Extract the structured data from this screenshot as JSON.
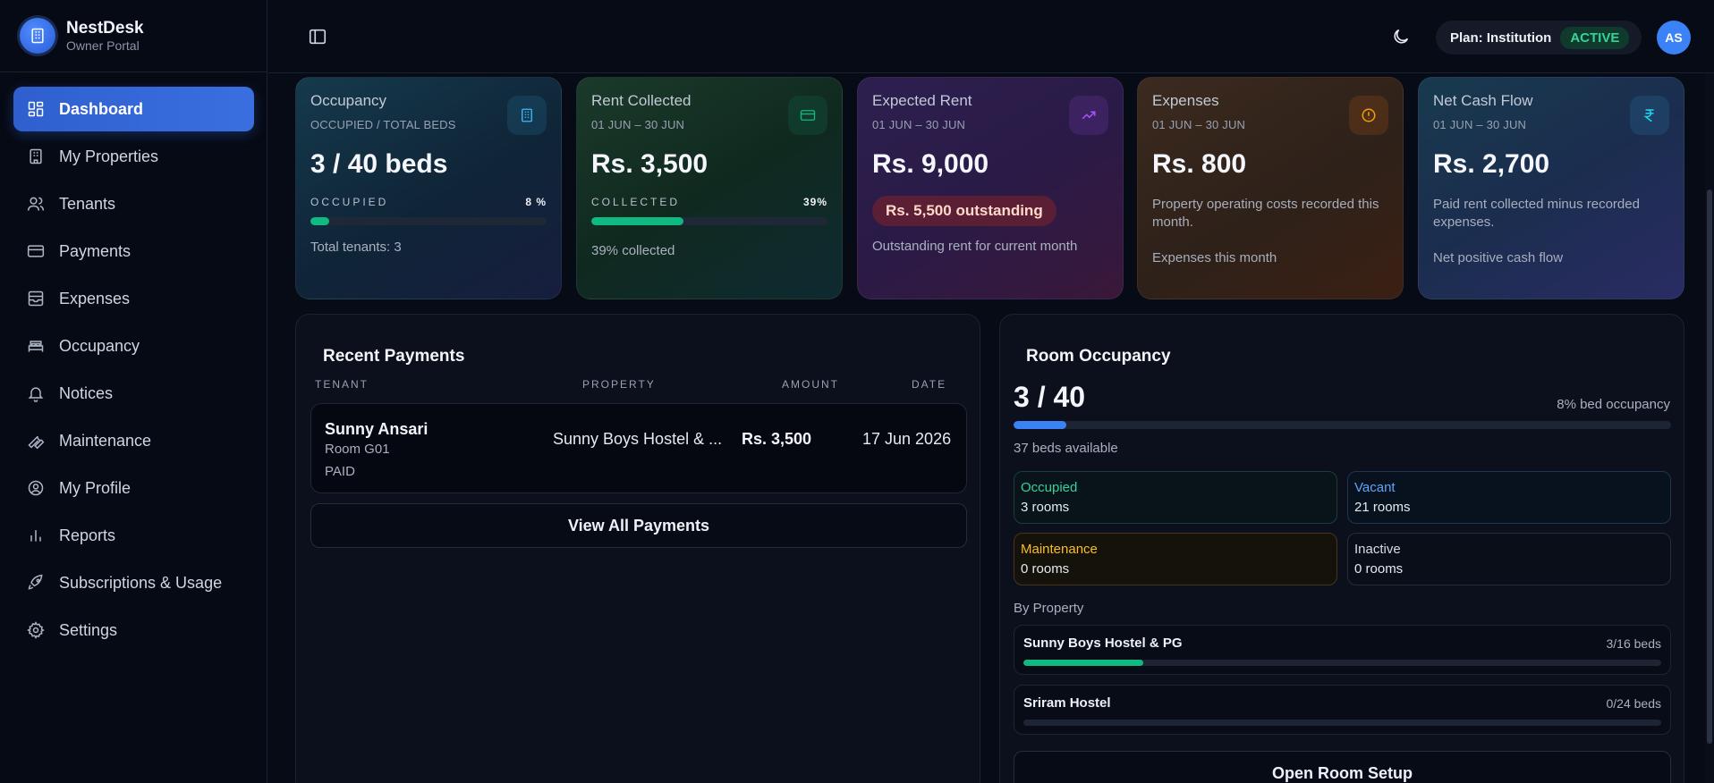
{
  "brand": {
    "name": "NestDesk",
    "subtitle": "Owner Portal"
  },
  "sidebar": {
    "items": [
      {
        "label": "Dashboard",
        "icon": "dashboard-icon",
        "active": true
      },
      {
        "label": "My Properties",
        "icon": "building-icon"
      },
      {
        "label": "Tenants",
        "icon": "users-icon"
      },
      {
        "label": "Payments",
        "icon": "credit-card-icon"
      },
      {
        "label": "Expenses",
        "icon": "archive-icon"
      },
      {
        "label": "Occupancy",
        "icon": "bed-icon"
      },
      {
        "label": "Notices",
        "icon": "bell-icon"
      },
      {
        "label": "Maintenance",
        "icon": "wrench-icon"
      },
      {
        "label": "My Profile",
        "icon": "user-circle-icon"
      },
      {
        "label": "Reports",
        "icon": "bar-chart-icon"
      },
      {
        "label": "Subscriptions & Usage",
        "icon": "rocket-icon"
      },
      {
        "label": "Settings",
        "icon": "gear-icon"
      }
    ]
  },
  "header": {
    "plan_label": "Plan: Institution",
    "plan_status": "ACTIVE",
    "avatar_initials": "AS"
  },
  "cards": {
    "occupancy": {
      "title": "Occupancy",
      "subtitle": "OCCUPIED / TOTAL BEDS",
      "value": "3 / 40 beds",
      "bar_label": "OCCUPIED",
      "bar_pct_text": "8 %",
      "bar_fraction": 0.08,
      "footer": "Total tenants: 3",
      "icon": "building-icon"
    },
    "rent_collected": {
      "title": "Rent Collected",
      "subtitle": "01 JUN – 30 JUN",
      "value": "Rs. 3,500",
      "bar_label": "COLLECTED",
      "bar_pct_text": "39%",
      "bar_fraction": 0.39,
      "footer": "39% collected",
      "icon": "credit-card-icon"
    },
    "expected_rent": {
      "title": "Expected Rent",
      "subtitle": "01 JUN – 30 JUN",
      "value": "Rs. 9,000",
      "badge": "Rs. 5,500 outstanding",
      "footer": "Outstanding rent for current month",
      "icon": "trending-up-icon"
    },
    "expenses": {
      "title": "Expenses",
      "subtitle": "01 JUN – 30 JUN",
      "value": "Rs. 800",
      "description": "Property operating costs recorded this month.",
      "footer": "Expenses this month",
      "icon": "alert-circle-icon"
    },
    "net_cash_flow": {
      "title": "Net Cash Flow",
      "subtitle": "01 JUN – 30 JUN",
      "value": "Rs. 2,700",
      "description": "Paid rent collected minus recorded expenses.",
      "footer": "Net positive cash flow",
      "icon": "rupee-icon"
    }
  },
  "recent_payments": {
    "title": "Recent Payments",
    "columns": [
      "TENANT",
      "PROPERTY",
      "AMOUNT",
      "DATE"
    ],
    "rows": [
      {
        "tenant": "Sunny Ansari",
        "room": "Room G01",
        "status": "PAID",
        "property": "Sunny Boys Hostel & ...",
        "amount": "Rs. 3,500",
        "date": "17 Jun 2026"
      }
    ],
    "view_all_label": "View All Payments"
  },
  "room_occupancy": {
    "title": "Room Occupancy",
    "summary": "3 / 40",
    "pct_text": "8% bed occupancy",
    "fraction": 0.08,
    "available_text": "37 beds available",
    "tiles": {
      "occupied": {
        "label": "Occupied",
        "value": "3 rooms"
      },
      "vacant": {
        "label": "Vacant",
        "value": "21 rooms"
      },
      "maintenance": {
        "label": "Maintenance",
        "value": "0 rooms"
      },
      "inactive": {
        "label": "Inactive",
        "value": "0 rooms"
      }
    },
    "by_property_label": "By Property",
    "properties": [
      {
        "name": "Sunny Boys Hostel & PG",
        "beds": "3/16 beds",
        "fraction": 0.1875
      },
      {
        "name": "Sriram Hostel",
        "beds": "0/24 beds",
        "fraction": 0
      }
    ],
    "open_setup_label": "Open Room Setup"
  },
  "colors": {
    "accent": "#3b82f6",
    "success": "#10b981",
    "warning": "#fbbf24",
    "active_badge": "#34d399"
  }
}
